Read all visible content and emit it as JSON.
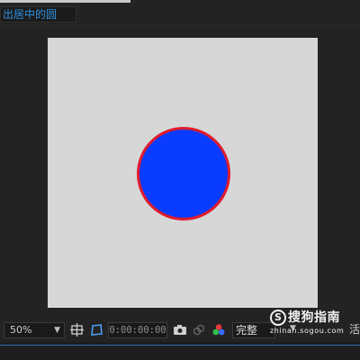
{
  "composition": {
    "tab_title": "出居中的圆"
  },
  "viewer": {
    "background_color": "#d7d7d7",
    "shape": {
      "name": "circle",
      "fill": "#0a3cff",
      "stroke": "#e01b2c"
    }
  },
  "toolbar": {
    "zoom_value": "50%",
    "timecode": "0:00:00:00",
    "quality_value": "完整",
    "trailing_text": "活",
    "icons": [
      "region-of-interest-icon",
      "transparency-grid-icon",
      "snapshot-camera-icon",
      "show-snapshot-icon",
      "color-channels-icon"
    ]
  },
  "watermark": {
    "main": "搜狗指南",
    "sub": "zhinan.sogou.com"
  }
}
